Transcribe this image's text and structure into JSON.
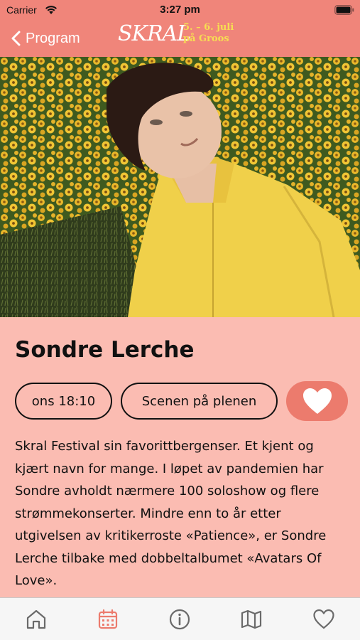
{
  "status_bar": {
    "carrier": "Carrier",
    "time": "3:27 pm"
  },
  "nav": {
    "back_label": "Program",
    "logo_text": "SKRAL",
    "logo_dates_line1": "5. – 6. juli",
    "logo_dates_line2": "på Groos"
  },
  "artist": {
    "name": "Sondre Lerche",
    "time": "ons 18:10",
    "stage": "Scenen på plenen",
    "description": "Skral Festival sin favorittbergenser. Et kjent og kjært navn for mange. I løpet av pandemien har Sondre avholdt nærmere 100 soloshow og flere strømmekonserter. Mindre enn to år etter utgivelsen av kritikerroste «Patience», er Sondre Lerche tilbake med dobbeltalbumet «Avatars Of Love»."
  },
  "tabs": [
    {
      "icon": "home-icon"
    },
    {
      "icon": "calendar-icon",
      "active": true
    },
    {
      "icon": "info-icon"
    },
    {
      "icon": "map-icon"
    },
    {
      "icon": "heart-icon"
    }
  ],
  "colors": {
    "header": "#f0857a",
    "content_bg": "#fbbcb2",
    "favorite_button": "#ec7b6d",
    "logo_dates": "#f7dd52",
    "tab_active": "#ec7b6d",
    "tab_inactive": "#6a6a6a"
  }
}
